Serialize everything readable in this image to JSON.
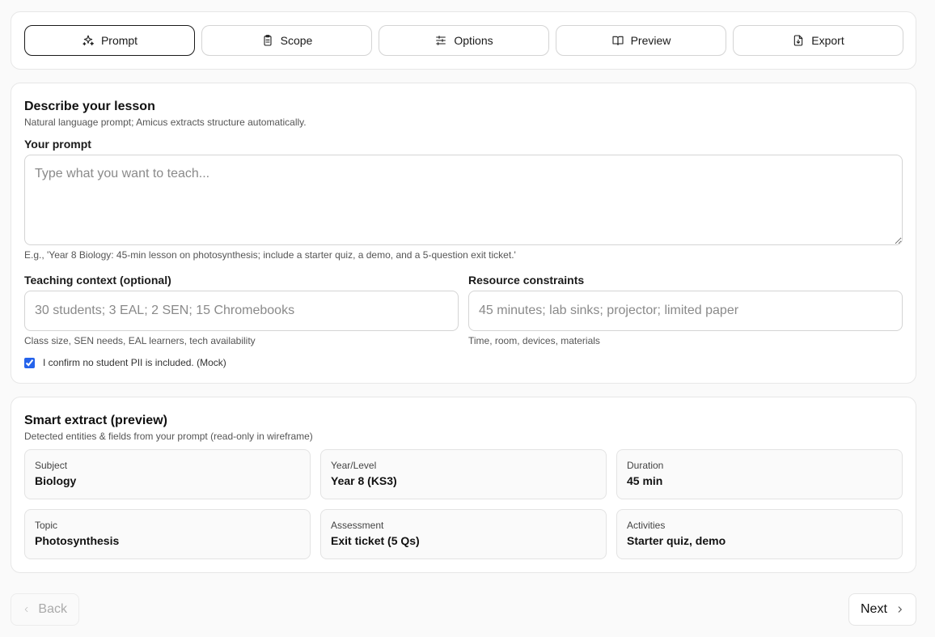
{
  "tabs": [
    {
      "label": "Prompt",
      "icon": "sparkles-icon",
      "active": true
    },
    {
      "label": "Scope",
      "icon": "clipboard-icon",
      "active": false
    },
    {
      "label": "Options",
      "icon": "sliders-icon",
      "active": false
    },
    {
      "label": "Preview",
      "icon": "book-open-icon",
      "active": false
    },
    {
      "label": "Export",
      "icon": "file-download-icon",
      "active": false
    }
  ],
  "describe": {
    "title": "Describe your lesson",
    "subtitle": "Natural language prompt; Amicus extracts structure automatically.",
    "prompt_label": "Your prompt",
    "prompt_placeholder": "Type what you want to teach...",
    "prompt_value": "",
    "prompt_hint": "E.g., 'Year 8 Biology: 45-min lesson on photosynthesis; include a starter quiz, a demo, and a 5-question exit ticket.'",
    "context_label": "Teaching context (optional)",
    "context_placeholder": "30 students; 3 EAL; 2 SEN; 15 Chromebooks",
    "context_hint": "Class size, SEN needs, EAL learners, tech availability",
    "constraints_label": "Resource constraints",
    "constraints_placeholder": "45 minutes; lab sinks; projector; limited paper",
    "constraints_hint": "Time, room, devices, materials",
    "confirm_label": "I confirm no student PII is included. (Mock)",
    "confirm_checked": true
  },
  "extract": {
    "title": "Smart extract (preview)",
    "subtitle": "Detected entities & fields from your prompt (read-only in wireframe)",
    "fields": [
      {
        "label": "Subject",
        "value": "Biology"
      },
      {
        "label": "Year/Level",
        "value": "Year 8 (KS3)"
      },
      {
        "label": "Duration",
        "value": "45 min"
      },
      {
        "label": "Topic",
        "value": "Photosynthesis"
      },
      {
        "label": "Assessment",
        "value": "Exit ticket (5 Qs)"
      },
      {
        "label": "Activities",
        "value": "Starter quiz, demo"
      }
    ]
  },
  "nav": {
    "back_label": "Back",
    "next_label": "Next"
  },
  "colors": {
    "accent": "#2563eb",
    "border": "#d4d4d4"
  }
}
